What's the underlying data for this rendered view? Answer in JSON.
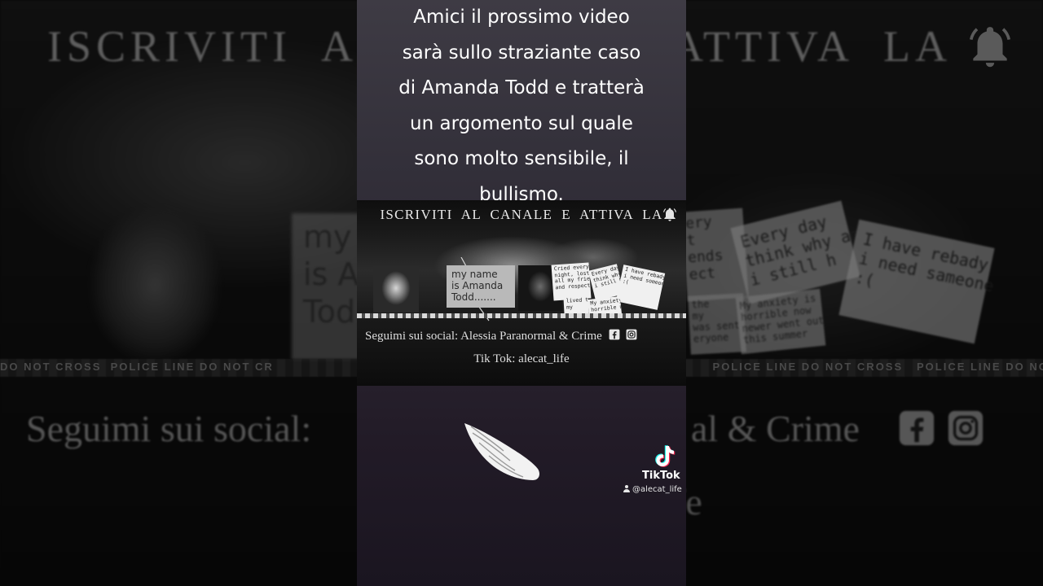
{
  "background": {
    "title": "ISCRIVITI  AL",
    "title_right": "ATTIVA  LA",
    "note_text": "my\nis A\nTod",
    "card1": "ery\nt\nends\nect",
    "card2": "Every day\nthink why am\ni still h",
    "card3": "I have rebady\ni need sameone\n:(",
    "card4": "the\nmy\nwas sent\neryone",
    "card5": "My anxiety is\nhorrible now\nnewer went out\nthis summer",
    "tape_text": "DO NOT CROSS  POLICE LINE DO NOT CR                                                                                                POLICE LINE DO NOT CROSS   POLICE LINE DO NOT CR",
    "social_left": "Seguimi sui social:",
    "social_right": "al & Crime",
    "life": "fe"
  },
  "caption": {
    "lines": [
      "Amici il prossimo video",
      "sarà sullo straziante caso",
      "di Amanda Todd e tratterà",
      "un argomento sul quale",
      "sono molto sensibile, il",
      "bullismo."
    ]
  },
  "banner": {
    "title": "ISCRIVITI  AL  CANALE  E  ATTIVA  LA",
    "note_name": "my name\nis Amanda\nTodd.......",
    "card1": "Cried every\nnight, lost\nall my friends\nand respect",
    "card2": "Every day\nthink why am\ni still h",
    "card3": "I have rebady\ni need someone\n:(",
    "card4": "lived the\nmy",
    "card5": "My anxiety is\nhorrible now",
    "social": "Seguimi sui social: Alessia Paranormal & Crime",
    "tiktok": "Tik Tok: alecat_life"
  },
  "watermark": {
    "brand": "TikTok",
    "username": "@alecat_life"
  },
  "icons": {
    "bell": "bell-icon",
    "facebook": "facebook-icon",
    "instagram": "instagram-icon",
    "wing": "angel-wing-icon",
    "tiktok": "tiktok-logo-icon",
    "user": "user-icon"
  },
  "colors": {
    "panel_top": "#3e3b44",
    "panel_bottom": "#1a1520",
    "caption_text": "#ffffff",
    "card_red_text": "#d31d1d"
  }
}
